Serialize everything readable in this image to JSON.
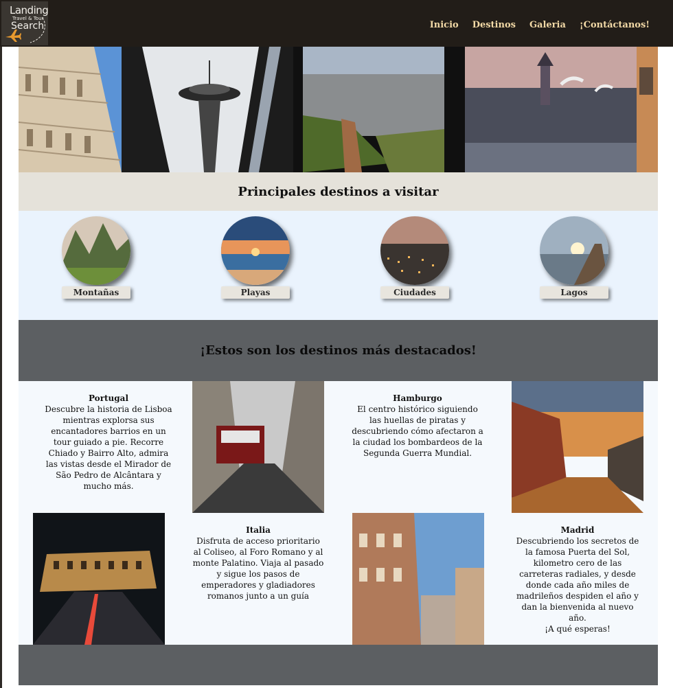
{
  "logo": {
    "line1": "Landing",
    "line2": "Travel & Tour",
    "line3": "Search"
  },
  "nav": {
    "items": [
      "Inicio",
      "Destinos",
      "Galeria",
      "¡Contáctanos!"
    ]
  },
  "main_title": "Principales destinos a visitar",
  "categories": [
    "Montañas",
    "Playas",
    "Ciudades",
    "Lagos"
  ],
  "featured_title": "¡Estos son los destinos más destacados!",
  "destinations": [
    {
      "name": "Portugal",
      "text": "Descubre la historia de Lisboa mientras explorsa sus encantadores barrios en un tour guiado a pie. Recorre Chiado y Bairro Alto, admira las vistas desde el Mirador de São Pedro de Alcântara y mucho más."
    },
    {
      "name": "Hamburgo",
      "text": "El centro histórico siguiendo las huellas de piratas y descubriendo cómo afectaron a la ciudad los bombardeos de la Segunda Guerra Mundial."
    },
    {
      "name": "Italia",
      "text": "Disfruta de acceso prioritario al Coliseo, al Foro Romano y al monte Palatino. Viaja al pasado y sigue los pasos de emperadores y gladiadores romanos junto a un guía"
    },
    {
      "name": "Madrid",
      "text": "Descubriendo los secretos de la famosa Puerta del Sol, kilometro cero de las carreteras radiales, y desde donde cada año miles de madrileños despiden el año y dan la bienvenida al nuevo año.",
      "extra": "¡A qué esperas!"
    }
  ],
  "colors": {
    "navbar": "#221d18",
    "nav_link": "#f2d9a6",
    "section_gray": "#5c5f62",
    "cat_bg": "#eaf3fd"
  }
}
